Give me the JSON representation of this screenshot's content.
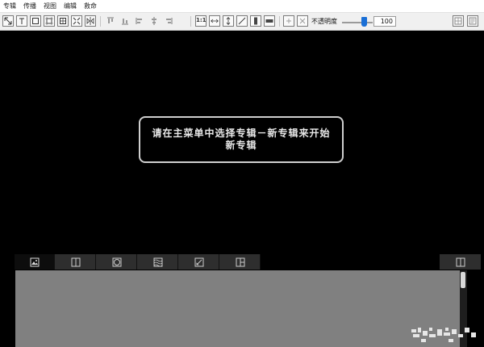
{
  "menubar": {
    "items": [
      "专辑",
      "传播",
      "视图",
      "编辑",
      "救命"
    ]
  },
  "toolbar": {
    "tools": [
      {
        "icon": "select-arrow-icon"
      },
      {
        "icon": "text-tool-icon"
      },
      {
        "icon": "rectangle-tool-icon"
      },
      {
        "icon": "frame-tool-icon"
      },
      {
        "icon": "crop-tool-icon"
      },
      {
        "icon": "fit-tool-icon"
      },
      {
        "icon": "flip-tool-icon"
      }
    ],
    "align": [
      {
        "icon": "align-top-icon"
      },
      {
        "icon": "align-bottom-icon"
      },
      {
        "icon": "align-left-icon"
      },
      {
        "icon": "align-center-icon"
      },
      {
        "icon": "align-right-icon"
      }
    ],
    "size": [
      {
        "icon": "actual-size-icon",
        "label": "1:1"
      },
      {
        "icon": "fit-width-icon"
      },
      {
        "icon": "fit-height-icon"
      },
      {
        "icon": "diagonal-resize-icon"
      },
      {
        "icon": "fill-vertical-icon"
      },
      {
        "icon": "fill-horizontal-icon"
      }
    ],
    "edit": [
      {
        "icon": "add-icon"
      },
      {
        "icon": "delete-icon"
      }
    ],
    "opacity_label": "不透明度",
    "opacity_value": "100",
    "opacity_fraction": 0.72,
    "view": [
      {
        "icon": "grid-view-icon"
      },
      {
        "icon": "text-view-icon"
      }
    ]
  },
  "canvas": {
    "hint": "请在主菜单中选择专辑－新专辑来开始新专辑"
  },
  "strip": {
    "tabs": [
      {
        "icon": "image-icon"
      },
      {
        "icon": "layout-icon"
      },
      {
        "icon": "circle-icon"
      },
      {
        "icon": "wave-pattern-icon"
      },
      {
        "icon": "pencil-icon"
      },
      {
        "icon": "quad-layout-icon"
      }
    ],
    "right_tab": {
      "icon": "panel-layout-icon"
    }
  },
  "colors": {
    "accent": "#1a6fd6",
    "panel_gray": "#808080",
    "canvas": "#000000"
  }
}
